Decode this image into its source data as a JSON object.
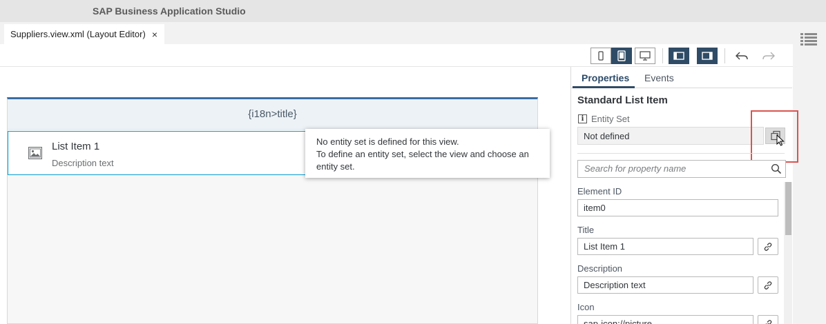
{
  "app": {
    "title": "SAP Business Application Studio"
  },
  "editor_tab": {
    "label": "Suppliers.view.xml (Layout Editor)",
    "close_glyph": "×"
  },
  "toolbar": {
    "buttons": [
      "phone-icon",
      "tablet-icon",
      "desktop-icon",
      "left-panel-icon",
      "right-panel-icon",
      "undo-icon",
      "redo-icon"
    ]
  },
  "canvas": {
    "header_title": "{i18n>title}",
    "list_item": {
      "title": "List Item 1",
      "description": "Description text",
      "icon": "picture-icon"
    }
  },
  "tooltip": {
    "line1": "No entity set is defined for this view.",
    "line2": "To define an entity set, select the view and choose an entity set."
  },
  "properties": {
    "tabs": [
      {
        "label": "Properties",
        "active": true
      },
      {
        "label": "Events",
        "active": false
      }
    ],
    "section_title": "Standard List Item",
    "entity_set": {
      "info_glyph": "i",
      "label": "Entity Set",
      "value": "Not defined"
    },
    "search_placeholder": "Search for property name",
    "fields": [
      {
        "label": "Element ID",
        "value": "item0"
      },
      {
        "label": "Title",
        "value": "List Item 1"
      },
      {
        "label": "Description",
        "value": "Description text"
      },
      {
        "label": "Icon",
        "value": "sap-icon://picture"
      }
    ]
  },
  "colors": {
    "accent": "#2f4b66",
    "highlight": "#d9534f",
    "selection": "#0a9dd1"
  }
}
